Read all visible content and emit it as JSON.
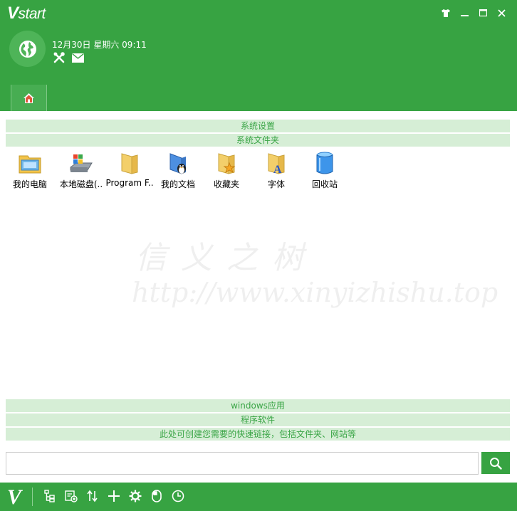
{
  "app": {
    "logo_v": "V",
    "logo_rest": "start",
    "datetime": "12月30日 星期六 09:11",
    "footer_logo": "V"
  },
  "window_controls": [
    "skin-icon",
    "minimize-icon",
    "maximize-icon",
    "close-icon"
  ],
  "sections_top": [
    {
      "label": "系统设置"
    },
    {
      "label": "系统文件夹"
    }
  ],
  "files": [
    {
      "label": "我的电脑",
      "icon": "computer-icon"
    },
    {
      "label": "本地磁盘(..",
      "icon": "local-disk-icon"
    },
    {
      "label": "Program F..",
      "icon": "folder-icon"
    },
    {
      "label": "我的文档",
      "icon": "my-documents-icon"
    },
    {
      "label": "收藏夹",
      "icon": "favorites-folder-icon"
    },
    {
      "label": "字体",
      "icon": "fonts-folder-icon"
    },
    {
      "label": "回收站",
      "icon": "recycle-bin-icon"
    }
  ],
  "watermark": {
    "line1": "信义之树",
    "line2": "http://www.xinyizhishu.top"
  },
  "sections_bottom": [
    {
      "label": "windows应用"
    },
    {
      "label": "程序软件"
    },
    {
      "label": "此处可创建您需要的快速链接，包括文件夹、网站等"
    }
  ],
  "search": {
    "placeholder": "",
    "value": ""
  },
  "colors": {
    "brand_green": "#37a342",
    "section_bg": "#d6eed6",
    "section_text": "#3aa546"
  },
  "footer_tools": [
    "tree-icon",
    "add-item-icon",
    "sort-icon",
    "plus-icon",
    "settings-gear-icon",
    "mouse-icon",
    "clock-icon"
  ]
}
